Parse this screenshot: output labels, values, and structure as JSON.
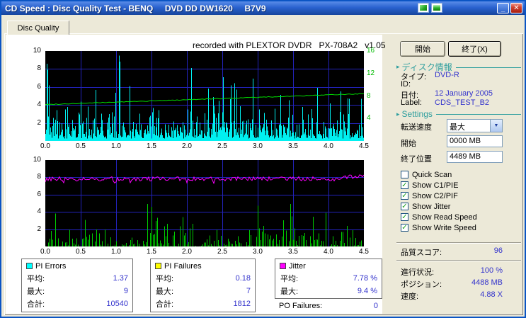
{
  "window": {
    "title": "CD Speed : Disc Quality Test - BENQ     DVD DD DW1620     B7V9"
  },
  "tab": {
    "label": "Disc Quality"
  },
  "chart_header": "recorded with PLEXTOR DVDR   PX-708A2   v1.05",
  "chart_data": [
    {
      "id": "pi_errors_chart",
      "type": "bar",
      "x_ticks": [
        "0.0",
        "0.5",
        "1.0",
        "1.5",
        "2.0",
        "2.5",
        "3.0",
        "3.5",
        "4.0",
        "4.5"
      ],
      "x_range": [
        0,
        4.5
      ],
      "left_axis": {
        "range": [
          0,
          10
        ],
        "ticks": [
          "10",
          "8",
          "6",
          "4",
          "2"
        ]
      },
      "right_axis": {
        "range": [
          0,
          16
        ],
        "ticks": [
          "16",
          "12",
          "8",
          "4"
        ],
        "color": "#00BB00"
      },
      "background": "#000000",
      "grid_color": "#2323BB",
      "series": [
        {
          "name": "PI Errors",
          "type": "bar",
          "color": "#00F0F0",
          "average": 1.37,
          "max": 9,
          "total": 10540
        },
        {
          "name": "Write Speed",
          "type": "line",
          "color": "#00DD00",
          "start_value": 4.05,
          "end_value": 5.25,
          "axis": "left"
        }
      ]
    },
    {
      "id": "pi_failures_jitter_chart",
      "type": "bar",
      "x_ticks": [
        "0.0",
        "0.5",
        "1.0",
        "1.5",
        "2.0",
        "2.5",
        "3.0",
        "3.5",
        "4.0",
        "4.5"
      ],
      "x_range": [
        0,
        4.5
      ],
      "left_axis": {
        "range": [
          0,
          10
        ],
        "ticks": [
          "10",
          "8",
          "6",
          "4",
          "2"
        ]
      },
      "background": "#000000",
      "grid_color": "#2323BB",
      "series": [
        {
          "name": "PI Failures",
          "type": "bar",
          "color": "#00CC00",
          "average": 0.18,
          "max": 7,
          "total": 1812
        },
        {
          "name": "Jitter",
          "type": "line",
          "color": "#FF00FF",
          "average": 7.78,
          "max": 9.4
        }
      ]
    }
  ],
  "right_panel": {
    "actions": {
      "start": "開始",
      "exit": "終了(X)"
    },
    "disc_info": {
      "header": "ディスク情報",
      "rows": [
        {
          "label": "タイプ:",
          "value": "DVD-R"
        },
        {
          "label": "ID:",
          "value": ""
        },
        {
          "label": "日付:",
          "value": "12 January 2005"
        },
        {
          "label": "Label:",
          "value": "CDS_TEST_B2"
        }
      ]
    },
    "settings": {
      "header": "Settings",
      "speed": {
        "label": "転送速度",
        "value": "最大"
      },
      "start": {
        "label": "開始",
        "value": "0000 MB"
      },
      "end": {
        "label": "終了位置",
        "value": "4489 MB"
      },
      "checkboxes": [
        {
          "label": "Quick Scan",
          "checked": false
        },
        {
          "label": "Show C1/PIE",
          "checked": true
        },
        {
          "label": "Show C2/PIF",
          "checked": true
        },
        {
          "label": "Show Jitter",
          "checked": true
        },
        {
          "label": "Show Read Speed",
          "checked": true
        },
        {
          "label": "Show Write Speed",
          "checked": true
        }
      ]
    },
    "status": {
      "quality": {
        "label": "品質スコア:",
        "value": "96"
      },
      "progress": {
        "label": "進行状況:",
        "value": "100 %"
      },
      "position": {
        "label": "ポジション:",
        "value": "4488 MB"
      },
      "speed": {
        "label": "速度:",
        "value": "4.88 X"
      }
    }
  },
  "stats_boxes": [
    {
      "title": "PI Errors",
      "swatch_color": "#00FFFF",
      "rows": [
        {
          "label": "平均:",
          "value": "1.37"
        },
        {
          "label": "最大:",
          "value": "9"
        },
        {
          "label": "合計:",
          "value": "10540"
        }
      ]
    },
    {
      "title": "PI Failures",
      "swatch_color": "#FFFF00",
      "rows": [
        {
          "label": "平均:",
          "value": "0.18"
        },
        {
          "label": "最大:",
          "value": "7"
        },
        {
          "label": "合計:",
          "value": "1812"
        }
      ]
    },
    {
      "title": "Jitter",
      "swatch_color": "#FF00FF",
      "rows": [
        {
          "label": "平均:",
          "value": "7.78 %"
        },
        {
          "label": "最大:",
          "value": "9.4 %"
        }
      ],
      "extra": {
        "label": "PO Failures:",
        "value": "0"
      }
    }
  ],
  "icons": {
    "minimize": "_",
    "close": "✕",
    "dropdown_arrow": "▼",
    "check": "✓",
    "section_arrow": "▸"
  }
}
